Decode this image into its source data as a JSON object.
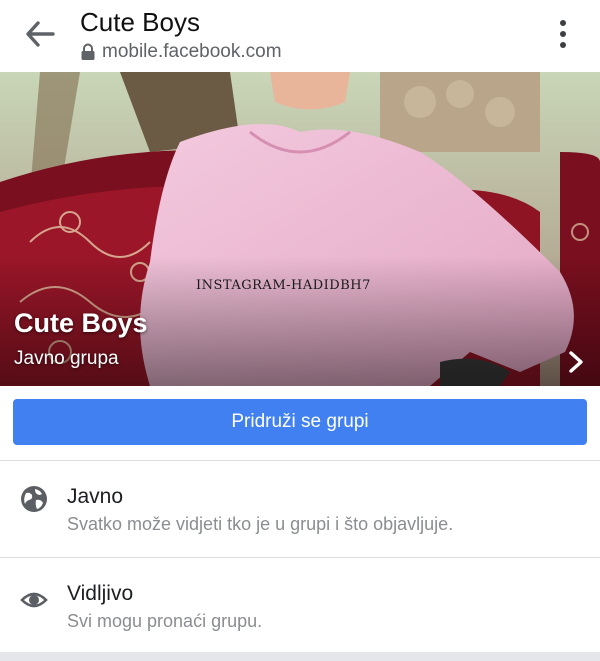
{
  "browser": {
    "title": "Cute Boys",
    "url": "mobile.facebook.com",
    "icons": {
      "back": "arrow-left-icon",
      "lock": "lock-icon",
      "menu": "more-vert-icon"
    }
  },
  "cover": {
    "watermark": "Instagram-hadidbh7",
    "title": "Cute Boys",
    "subtitle": "Javno grupa",
    "icon": "chevron-right-icon"
  },
  "join_button": {
    "label": "Pridruži se grupi",
    "color": "#4080f0"
  },
  "info": [
    {
      "icon": "globe-icon",
      "title": "Javno",
      "description": "Svatko može vidjeti tko je u grupi i što objavljuje."
    },
    {
      "icon": "eye-icon",
      "title": "Vidljivo",
      "description": "Svi mogu pronaći grupu."
    }
  ]
}
